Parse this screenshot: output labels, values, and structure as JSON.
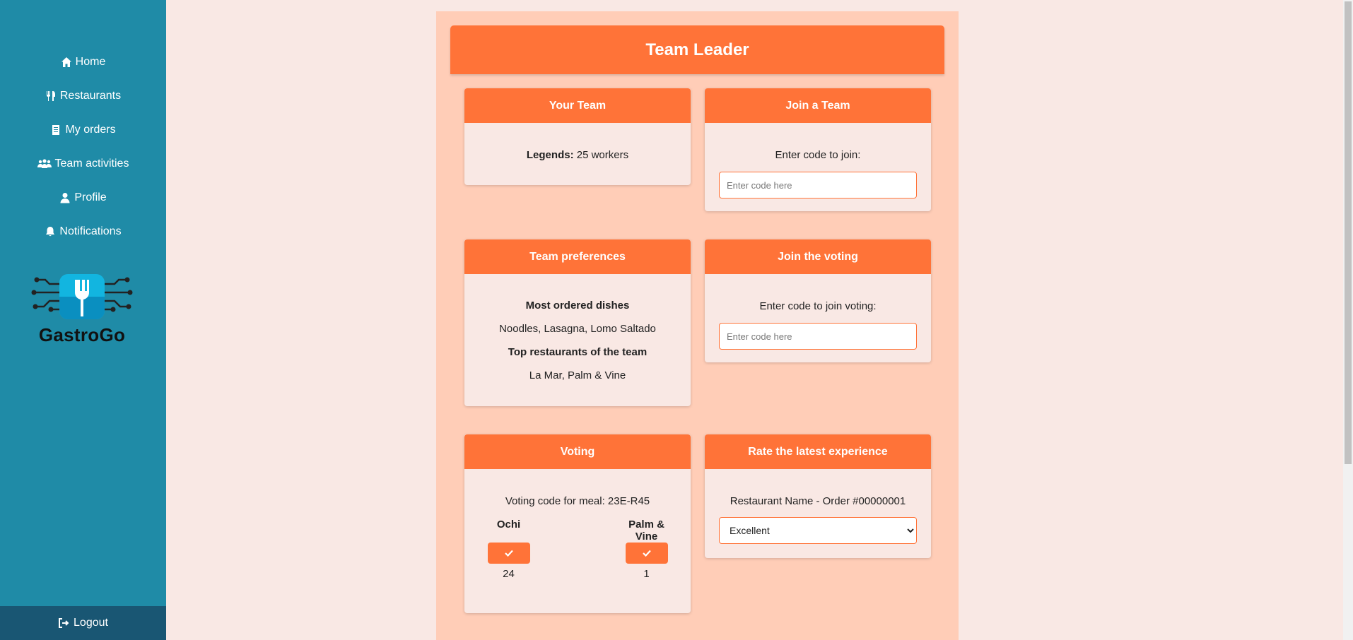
{
  "sidebar": {
    "items": [
      {
        "label": "Home",
        "icon": "home-icon"
      },
      {
        "label": "Restaurants",
        "icon": "utensils-icon"
      },
      {
        "label": "My orders",
        "icon": "receipt-icon"
      },
      {
        "label": "Team activities",
        "icon": "people-icon"
      },
      {
        "label": "Profile",
        "icon": "user-icon"
      },
      {
        "label": "Notifications",
        "icon": "bell-icon"
      }
    ],
    "logo_text": "GastroGo",
    "logout_label": "Logout"
  },
  "page": {
    "title": "Team Leader"
  },
  "your_team": {
    "title": "Your Team",
    "team_name": "Legends:",
    "workers": " 25 workers"
  },
  "join_team": {
    "title": "Join a Team",
    "prompt": "Enter code to join:",
    "placeholder": "Enter code here"
  },
  "preferences": {
    "title": "Team preferences",
    "dishes_heading": "Most ordered dishes",
    "dishes": "Noodles, Lasagna, Lomo Saltado",
    "restaurants_heading": "Top restaurants of the team",
    "restaurants": "La Mar, Palm & Vine"
  },
  "join_voting": {
    "title": "Join the voting",
    "prompt": "Enter code to join voting:",
    "placeholder": "Enter code here"
  },
  "voting": {
    "title": "Voting",
    "code_text": "Voting code for meal: 23E-R45",
    "options": [
      {
        "name": "Ochi",
        "count": "24"
      },
      {
        "name": "Palm & Vine",
        "count": "1"
      }
    ]
  },
  "rate": {
    "title": "Rate the latest experience",
    "order_text": "Restaurant Name - Order #00000001",
    "selected": "Excellent"
  },
  "colors": {
    "sidebar": "#1f8ba7",
    "accent": "#ff7338",
    "panel": "#ffcdb7",
    "card": "#f9e8e4",
    "logout_bg": "#195673"
  }
}
